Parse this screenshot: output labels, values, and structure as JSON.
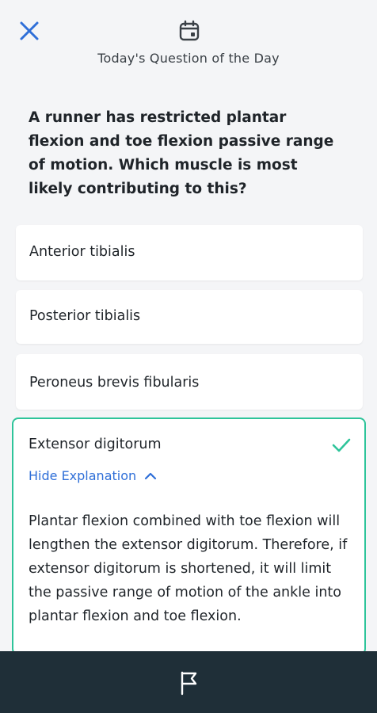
{
  "header": {
    "title": "Today's Question of the Day",
    "close_icon": "close-icon",
    "calendar_icon": "calendar-icon"
  },
  "question": {
    "text": "A runner has restricted plantar flexion and toe flexion passive range of motion. Which muscle is most likely contributing to this?"
  },
  "options": [
    {
      "label": "Anterior tibialis"
    },
    {
      "label": "Posterior tibialis"
    },
    {
      "label": "Peroneus brevis fibularis"
    },
    {
      "label": "Extensor digitorum",
      "selected": true,
      "correct": true
    }
  ],
  "explanation": {
    "toggle_label": "Hide Explanation",
    "text": "Plantar flexion combined with toe flexion will lengthen the extensor digitorum. Therefore, if extensor digitorum is shortened, it will limit the passive range of motion of the ankle into plantar flexion and toe flexion."
  },
  "bottom_bar": {
    "flag_icon": "flag-icon"
  },
  "colors": {
    "background": "#f4f5f7",
    "accent_blue": "#2f6fd8",
    "correct_green": "#2ec49a",
    "bottom_bar": "#1f2f38"
  }
}
